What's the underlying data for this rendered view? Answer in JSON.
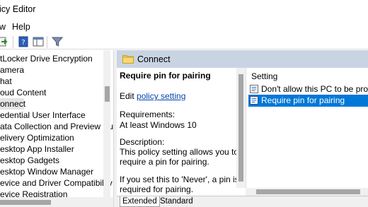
{
  "window": {
    "title": "icy Editor"
  },
  "menu": {
    "items": [
      "w",
      "Help"
    ]
  },
  "tree": {
    "items": [
      "tLocker Drive Encryption",
      "amera",
      "hat",
      "oud Content",
      "onnect",
      "edential User Interface",
      "ata Collection and Preview Builds",
      "elivery Optimization",
      "esktop App Installer",
      "esktop Gadgets",
      "esktop Window Manager",
      "evice and Driver Compatibility",
      "evice Registration"
    ],
    "selected_index": 4
  },
  "header": {
    "title": "Connect"
  },
  "description": {
    "title": "Require pin for pairing",
    "edit_prefix": "Edit ",
    "edit_link": "policy setting",
    "requirements_label": "Requirements:",
    "requirements_value": "At least Windows 10",
    "description_label": "Description:",
    "description_line1": "This policy setting allows you to",
    "description_line2": "require a pin for pairing.",
    "note_line1": "If you set this to 'Never', a pin isn't",
    "note_line2": "required for pairing."
  },
  "list": {
    "header": "Setting",
    "rows": [
      {
        "label": "Don't allow this PC to be projected to",
        "selected": false
      },
      {
        "label": "Require pin for pairing",
        "selected": true
      }
    ]
  },
  "tabs": [
    {
      "label": "Extended",
      "active": true
    },
    {
      "label": "Standard",
      "active": false
    }
  ],
  "colors": {
    "header_bg": "#c9d4e3",
    "selection": "#0078d7",
    "link": "#0645ad"
  }
}
